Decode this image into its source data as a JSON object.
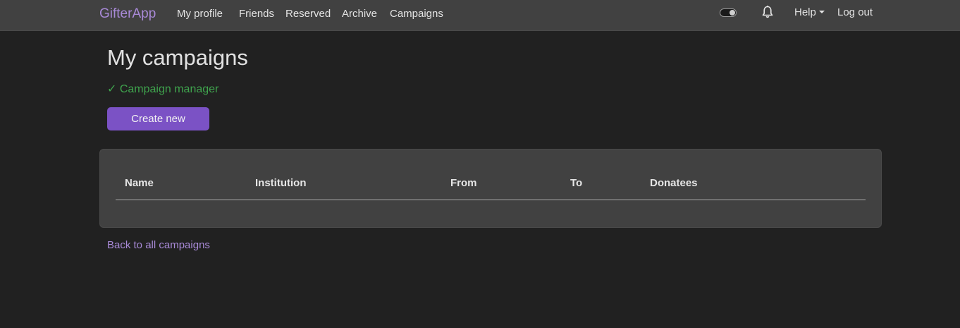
{
  "navbar": {
    "brand": "GifterApp",
    "links": [
      "My profile",
      "Friends",
      "Reserved",
      "Archive",
      "Campaigns"
    ],
    "help": "Help",
    "logout": "Log out"
  },
  "page": {
    "title": "My campaigns",
    "role_badge": "✓ Campaign manager",
    "create_button": "Create new",
    "back_link": "Back to all campaigns"
  },
  "table": {
    "columns": [
      "Name",
      "Institution",
      "From",
      "To",
      "Donatees"
    ],
    "rows": []
  },
  "icons": {
    "theme_toggle": "toggle-icon",
    "notifications": "bell-icon"
  },
  "colors": {
    "accent": "#7b52c5",
    "brand": "#a98ad8",
    "success": "#3fa34d",
    "background": "#212121",
    "surface": "#414141"
  }
}
